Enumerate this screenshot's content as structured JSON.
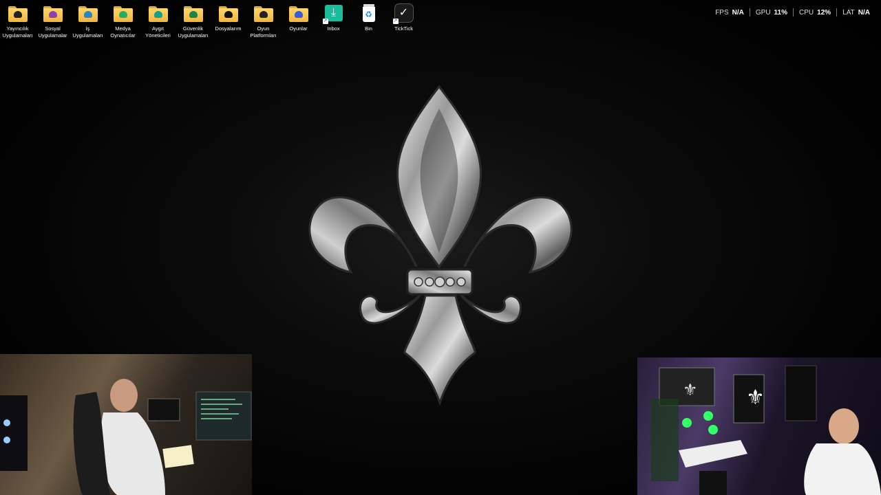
{
  "desktop": {
    "icons": [
      {
        "label": "Yayıncılık\nUygulamaları",
        "prefix": "⧉",
        "icon": "folder-streaming-icon",
        "badge": "#222"
      },
      {
        "label": "Sosyal\nUygulamalar",
        "prefix": "◯",
        "icon": "folder-social-icon",
        "badge": "#8e44ad"
      },
      {
        "label": "İş\nUygulamaları",
        "prefix": "◇",
        "icon": "folder-work-icon",
        "badge": "#2e86c1"
      },
      {
        "label": "Medya\nOynatıcılar",
        "prefix": "∩",
        "icon": "folder-media-icon",
        "badge": "#27ae60"
      },
      {
        "label": "Aygıt\nYöneticileri",
        "prefix": "⚙",
        "icon": "folder-devices-icon",
        "badge": "#16a085"
      },
      {
        "label": "Güvenlik\nUygulamaları",
        "prefix": "◐",
        "icon": "folder-security-icon",
        "badge": "#1e8449"
      },
      {
        "label": "Dosyalarım",
        "prefix": "▭",
        "icon": "folder-files-icon",
        "badge": "#111"
      },
      {
        "label": "Oyun\nPlatformları",
        "prefix": "■",
        "icon": "folder-game-platforms-icon",
        "badge": "#222"
      },
      {
        "label": "Oyunlar",
        "prefix": "▭",
        "icon": "folder-games-icon",
        "badge": "#3b5bdb"
      },
      {
        "label": "Inbox",
        "prefix": "⊡",
        "icon": "inbox-download-icon",
        "badge": "#1abc9c"
      },
      {
        "label": "Bin",
        "prefix": "▮",
        "icon": "recycle-bin-icon",
        "badge": "#ffffff"
      },
      {
        "label": "TickTick",
        "prefix": "",
        "icon": "ticktick-app-icon",
        "badge": "#1a1a1a"
      }
    ]
  },
  "perf_overlay": {
    "fps_label": "FPS",
    "fps_value": "N/A",
    "gpu_label": "GPU",
    "gpu_value": "11%",
    "cpu_label": "CPU",
    "cpu_value": "12%",
    "lat_label": "LAT",
    "lat_value": "N/A"
  },
  "colors": {
    "folder": "#f2b53c",
    "background": "#050505"
  }
}
